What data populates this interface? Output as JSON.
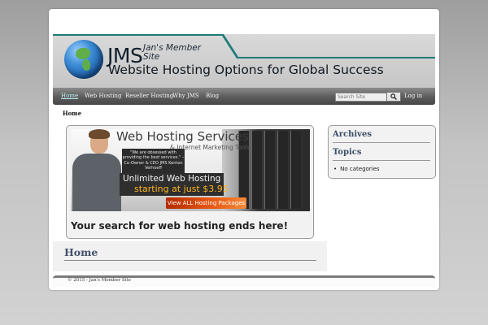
{
  "header": {
    "logo_text": "JMS",
    "logo_subtitle": "Jan's Member Site",
    "tagline": "Website Hosting Options for Global Success"
  },
  "nav": {
    "items": [
      "Home",
      "Web Hosting",
      "Reseller Hosting",
      "Why JMS",
      "Blog"
    ],
    "search_placeholder": "Search Site",
    "login_label": "Log in"
  },
  "breadcrumb": {
    "current": "Home"
  },
  "banner": {
    "title": "Web Hosting Services",
    "subtitle": "& Internet Marketing Tools",
    "quote": "\"We are obsessed with providing the best services.\" – Co-Owner & CEO JMS Kenton Verhoeff",
    "headline": "Unlimited Web Hosting",
    "price_line": "starting at just $3.95",
    "cta": "View ALL Hosting Packages"
  },
  "main": {
    "search_tagline": "Your search for web hosting ends here!",
    "section_heading": "Home"
  },
  "sidebar": {
    "archives_heading": "Archives",
    "topics_heading": "Topics",
    "topics_items": [
      "No categories"
    ]
  },
  "footer": {
    "text": "© 2015 - Jan's Member Site"
  },
  "colors": {
    "nav_active": "#b9f0f2",
    "price": "#ffb31f",
    "teal_accent": "#1f7b78",
    "heading": "#44516a"
  }
}
